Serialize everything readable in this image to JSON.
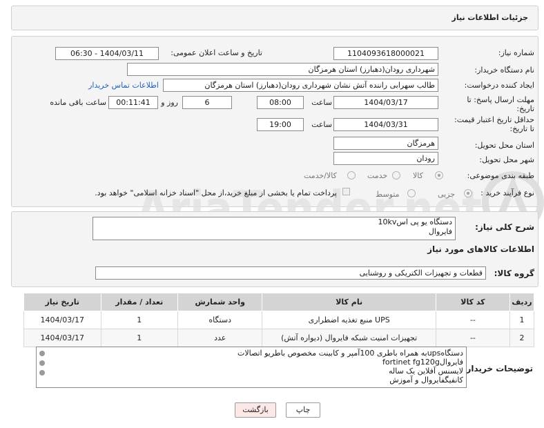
{
  "header": {
    "title": "جزئیات اطلاعات نیاز"
  },
  "form": {
    "need_number": {
      "label": "شماره نیاز:",
      "value": "1104093618000021"
    },
    "announce": {
      "label": "تاریخ و ساعت اعلان عمومی:",
      "value": "1404/03/11 - 06:30"
    },
    "buyer": {
      "label": "نام دستگاه خریدار:",
      "value": "شهرداری رودان(دهبارز) استان هرمزگان"
    },
    "creator": {
      "label": "ایجاد کننده درخواست:",
      "value": "طالب سهرابی راننده آتش نشان شهرداری رودان(دهبارز) استان هرمزگان",
      "contact_link": "اطلاعات تماس خریدار"
    },
    "deadline": {
      "label_line1": "مهلت ارسال پاسخ: تا",
      "label_line2": "تاریخ:",
      "date": "1404/03/17",
      "time_label": "ساعت",
      "time": "08:00",
      "days": "6",
      "days_label": "روز و",
      "remaining": "00:11:41",
      "remaining_label": "ساعت باقی مانده"
    },
    "price_validity": {
      "label_line1": "حداقل تاریخ اعتبار قیمت:",
      "label_line2": "تا تاریخ:",
      "date": "1404/03/31",
      "time_label": "ساعت",
      "time": "19:00"
    },
    "province": {
      "label": "استان محل تحویل:",
      "value": "هرمزگان"
    },
    "city": {
      "label": "شهر محل تحویل:",
      "value": "رودان"
    },
    "category": {
      "label": "طبقه بندی موضوعی:",
      "options": [
        "کالا",
        "خدمت",
        "کالا/خدمت"
      ],
      "selected": "کالا"
    },
    "process": {
      "label": "نوع فرآیند خرید :",
      "options": [
        "جزیی",
        "متوسط"
      ],
      "selected": "جزیی",
      "payment_note": "پرداخت تمام یا بخشی از مبلغ خرید،از محل \"اسناد خزانه اسلامی\" خواهد بود."
    }
  },
  "description": {
    "label": "شرح کلی نیاز:",
    "lines": [
      "دستگاه یو پی اس10kv",
      "فایروال"
    ]
  },
  "goods_info": {
    "title": "اطلاعات کالاهای مورد نیاز"
  },
  "goods_group": {
    "label": "گروه کالا:",
    "value": "قطعات و تجهیزات الکتریکی و روشنایی"
  },
  "table": {
    "headers": [
      "ردیف",
      "کد کالا",
      "نام کالا",
      "واحد شمارش",
      "تعداد / مقدار",
      "تاریخ نیاز"
    ],
    "rows": [
      [
        "1",
        "--",
        "منبع تغذیه اضطراری UPS",
        "دستگاه",
        "1",
        "1404/03/17"
      ],
      [
        "2",
        "--",
        "تجهیزات امنیت شبکه فایروال (دیواره آتش)",
        "عدد",
        "1",
        "1404/03/17"
      ]
    ]
  },
  "buyer_notes": {
    "label": "توضیحات خریدار:",
    "lines": [
      "دستگاهupsبه همراه باطری 100آمپر و کابینت مخصوص باطریو اتصالات",
      "فایروالfortinet fg120g",
      "لایسنس آفلاین یک ساله",
      "کانفیگفایروال و آموزش"
    ]
  },
  "buttons": {
    "print": "چاپ",
    "back": "بازگشت"
  },
  "colors": {
    "panel": "#f4f4f4",
    "table_header": "#d4d4d4",
    "link": "#1f5fbf",
    "back_button": "#fde8e8"
  }
}
